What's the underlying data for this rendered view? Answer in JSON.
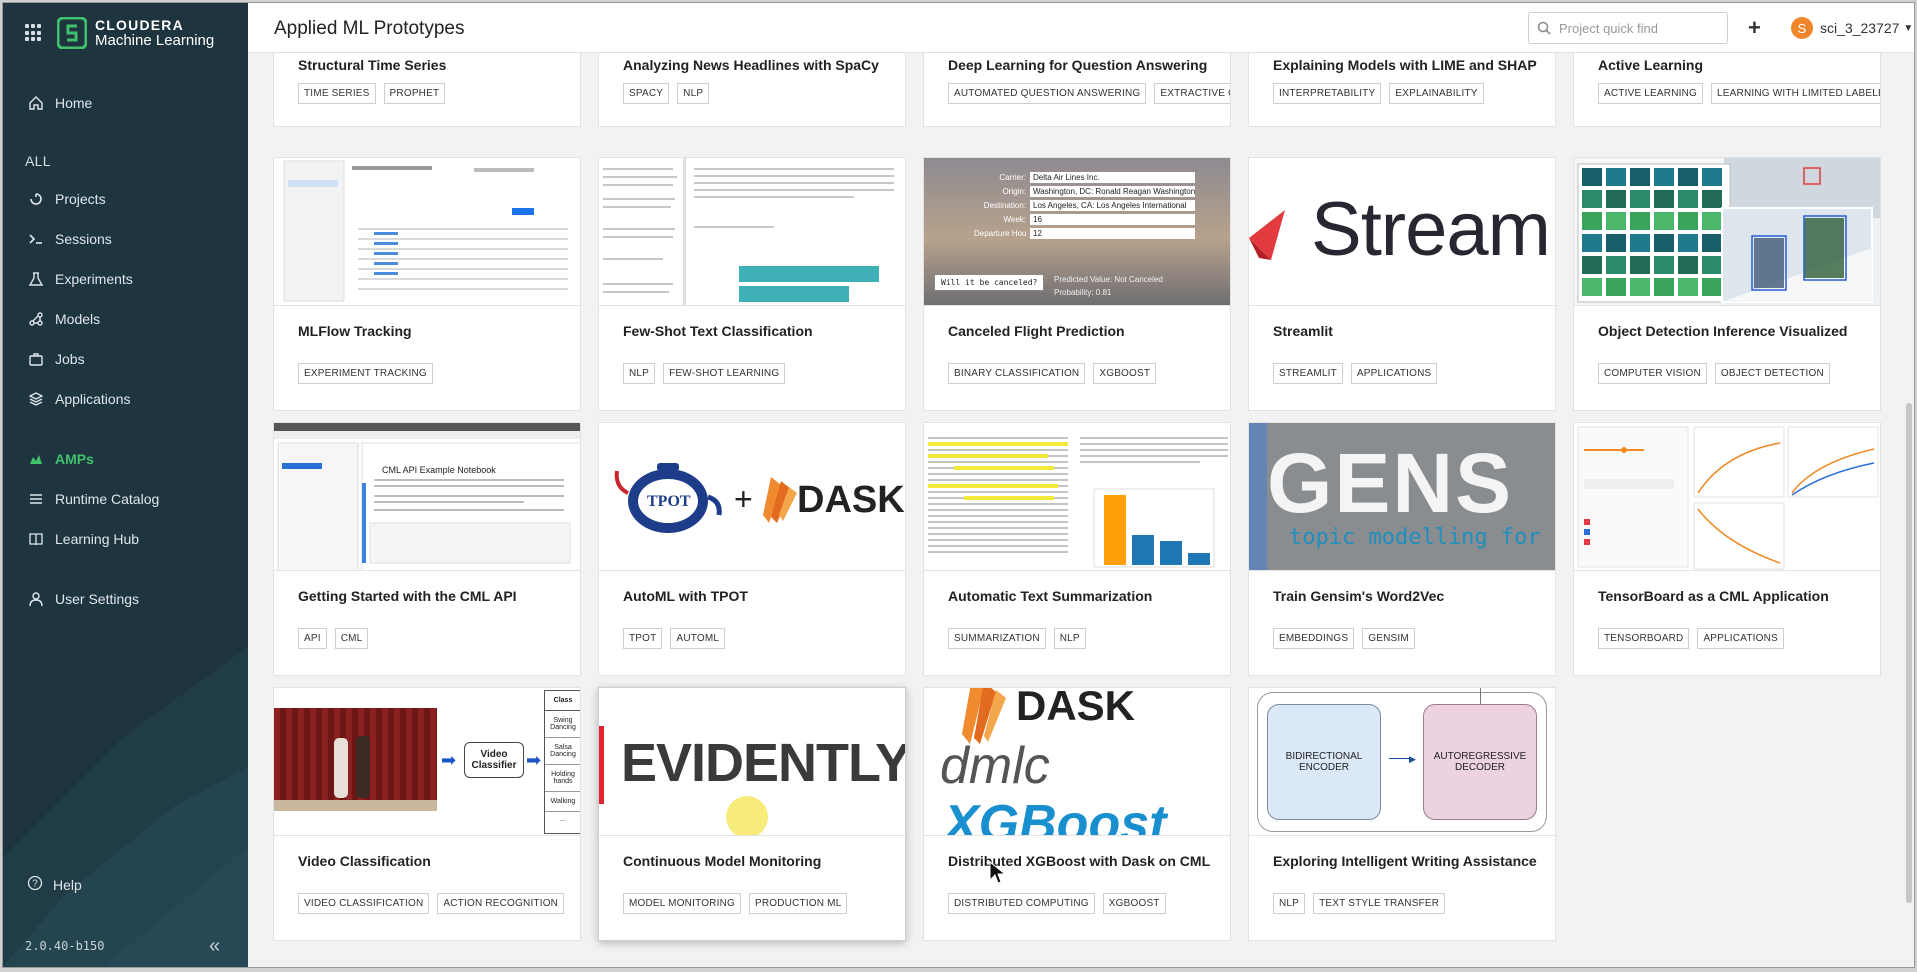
{
  "header": {
    "title": "Applied ML Prototypes",
    "search_placeholder": "Project quick find",
    "add_label": "+",
    "user_initial": "S",
    "username": "sci_3_23727"
  },
  "brand": {
    "line1": "CLOUDERA",
    "line2": "Machine Learning"
  },
  "sidebar": {
    "home": "Home",
    "section": "ALL",
    "items": [
      {
        "label": "Projects",
        "icon": "folder-icon"
      },
      {
        "label": "Sessions",
        "icon": "terminal-icon"
      },
      {
        "label": "Experiments",
        "icon": "flask-icon"
      },
      {
        "label": "Models",
        "icon": "models-icon"
      },
      {
        "label": "Jobs",
        "icon": "briefcase-icon"
      },
      {
        "label": "Applications",
        "icon": "layers-icon"
      }
    ],
    "amps": "AMPs",
    "runtime_catalog": "Runtime Catalog",
    "learning_hub": "Learning Hub",
    "user_settings": "User Settings",
    "help": "Help",
    "version": "2.0.40-b150",
    "accent": "#41c06b"
  },
  "cards": [
    {
      "title": "Structural Time Series",
      "tags": [
        "TIME SERIES",
        "PROPHET"
      ]
    },
    {
      "title": "Analyzing News Headlines with SpaCy",
      "tags": [
        "SPACY",
        "NLP"
      ]
    },
    {
      "title": "Deep Learning for Question Answering",
      "tags": [
        "AUTOMATED QUESTION ANSWERING",
        "EXTRACTIVE QUESTI"
      ]
    },
    {
      "title": "Explaining Models with LIME and SHAP",
      "tags": [
        "INTERPRETABILITY",
        "EXPLAINABILITY"
      ]
    },
    {
      "title": "Active Learning",
      "tags": [
        "ACTIVE LEARNING",
        "LEARNING WITH LIMITED LABELED DAT"
      ]
    },
    {
      "title": "MLFlow Tracking",
      "tags": [
        "EXPERIMENT TRACKING"
      ]
    },
    {
      "title": "Few-Shot Text Classification",
      "tags": [
        "NLP",
        "FEW-SHOT LEARNING"
      ]
    },
    {
      "title": "Canceled Flight Prediction",
      "tags": [
        "BINARY CLASSIFICATION",
        "XGBOOST"
      ]
    },
    {
      "title": "Streamlit",
      "tags": [
        "STREAMLIT",
        "APPLICATIONS"
      ]
    },
    {
      "title": "Object Detection Inference Visualized",
      "tags": [
        "COMPUTER VISION",
        "OBJECT DETECTION"
      ]
    },
    {
      "title": "Getting Started with the CML API",
      "tags": [
        "API",
        "CML"
      ]
    },
    {
      "title": "AutoML with TPOT",
      "tags": [
        "TPOT",
        "AUTOML"
      ]
    },
    {
      "title": "Automatic Text Summarization",
      "tags": [
        "SUMMARIZATION",
        "NLP"
      ]
    },
    {
      "title": "Train Gensim's Word2Vec",
      "tags": [
        "EMBEDDINGS",
        "GENSIM"
      ]
    },
    {
      "title": "TensorBoard as a CML Application",
      "tags": [
        "TENSORBOARD",
        "APPLICATIONS"
      ]
    },
    {
      "title": "Video Classification",
      "tags": [
        "VIDEO CLASSIFICATION",
        "ACTION RECOGNITION"
      ]
    },
    {
      "title": "Continuous Model Monitoring",
      "tags": [
        "MODEL MONITORING",
        "PRODUCTION ML"
      ]
    },
    {
      "title": "Distributed XGBoost with Dask on CML",
      "tags": [
        "DISTRIBUTED COMPUTING",
        "XGBOOST"
      ]
    },
    {
      "title": "Exploring Intelligent Writing Assistance",
      "tags": [
        "NLP",
        "TEXT STYLE TRANSFER"
      ]
    }
  ],
  "thumbs": {
    "flight": {
      "carrier_label": "Carrier:",
      "carrier": "Delta Air Lines Inc.",
      "origin_label": "Origin:",
      "origin": "Washington, DC: Ronald Reagan Washington Na...",
      "dest_label": "Destination:",
      "dest": "Los Angeles, CA: Los Angeles International",
      "week_label": "Week:",
      "week": "16",
      "dep_label": "Departure Hour:",
      "dep": "12",
      "button": "Will it be canceled?",
      "predicted": "Predicted Value: Not Canceled",
      "probability": "Probability: 0.81"
    },
    "streamlit": "Stream",
    "cml_api": "CML API Example Notebook",
    "tpot_plus": "+",
    "tpot_logo": "TPOT",
    "dask": "DASK",
    "gensim": "GENS",
    "gensim_sub": "topic modelling for",
    "video_box": "Video Classifier",
    "video_classes": [
      "Class",
      "Swing Dancing",
      "Salsa Dancing",
      "Holding hands",
      "Walking",
      "..."
    ],
    "evidently": "EVIDENTLY",
    "dmlc": "dmlc",
    "xgboost": "XGBoost",
    "enc": "BIDIRECTIONAL ENCODER",
    "dec": "AUTOREGRESSIVE DECODER"
  }
}
